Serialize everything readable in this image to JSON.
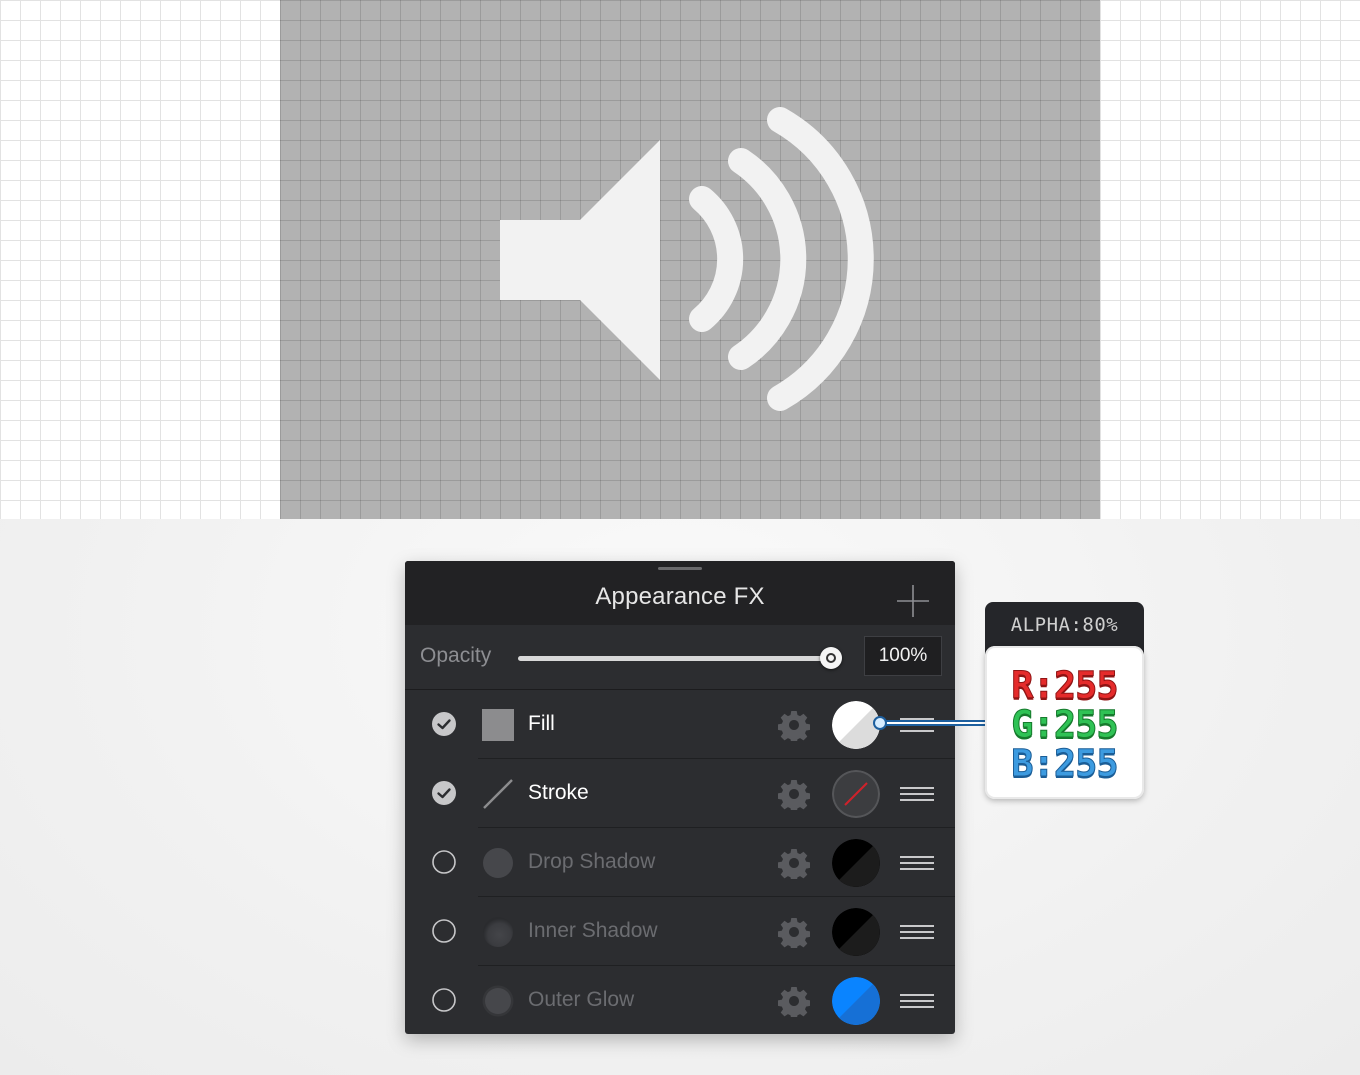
{
  "panel": {
    "title": "Appearance FX",
    "add_icon": "plus-icon",
    "opacity": {
      "label": "Opacity",
      "value_text": "100%",
      "level": 1.0
    },
    "effects": [
      {
        "label": "Fill",
        "enabled": true,
        "type_icon": "fill-square-icon",
        "swatch": "white-split",
        "colors": [
          "#ffffff",
          "#dcdcdc"
        ]
      },
      {
        "label": "Stroke",
        "enabled": true,
        "type_icon": "stroke-line-icon",
        "swatch": "none-red-slash",
        "colors": [
          "#3c3d40",
          "#d0212a"
        ]
      },
      {
        "label": "Drop Shadow",
        "enabled": false,
        "type_icon": "drop-shadow-icon",
        "swatch": "black-split",
        "colors": [
          "#000000",
          "#1a1a1a"
        ]
      },
      {
        "label": "Inner Shadow",
        "enabled": false,
        "type_icon": "inner-shadow-icon",
        "swatch": "black-split",
        "colors": [
          "#000000",
          "#1a1a1a"
        ]
      },
      {
        "label": "Outer Glow",
        "enabled": false,
        "type_icon": "outer-glow-icon",
        "swatch": "blue-split",
        "colors": [
          "#0a84ff",
          "#1670d6"
        ]
      }
    ]
  },
  "tooltip": {
    "alpha": "ALPHA:80%",
    "r": "R:255",
    "g": "G:255",
    "b": "B:255"
  },
  "canvas": {
    "artboard_color": "#b2b2b2",
    "icon": "speaker-volume-icon",
    "icon_color": "#f2f2f2"
  }
}
